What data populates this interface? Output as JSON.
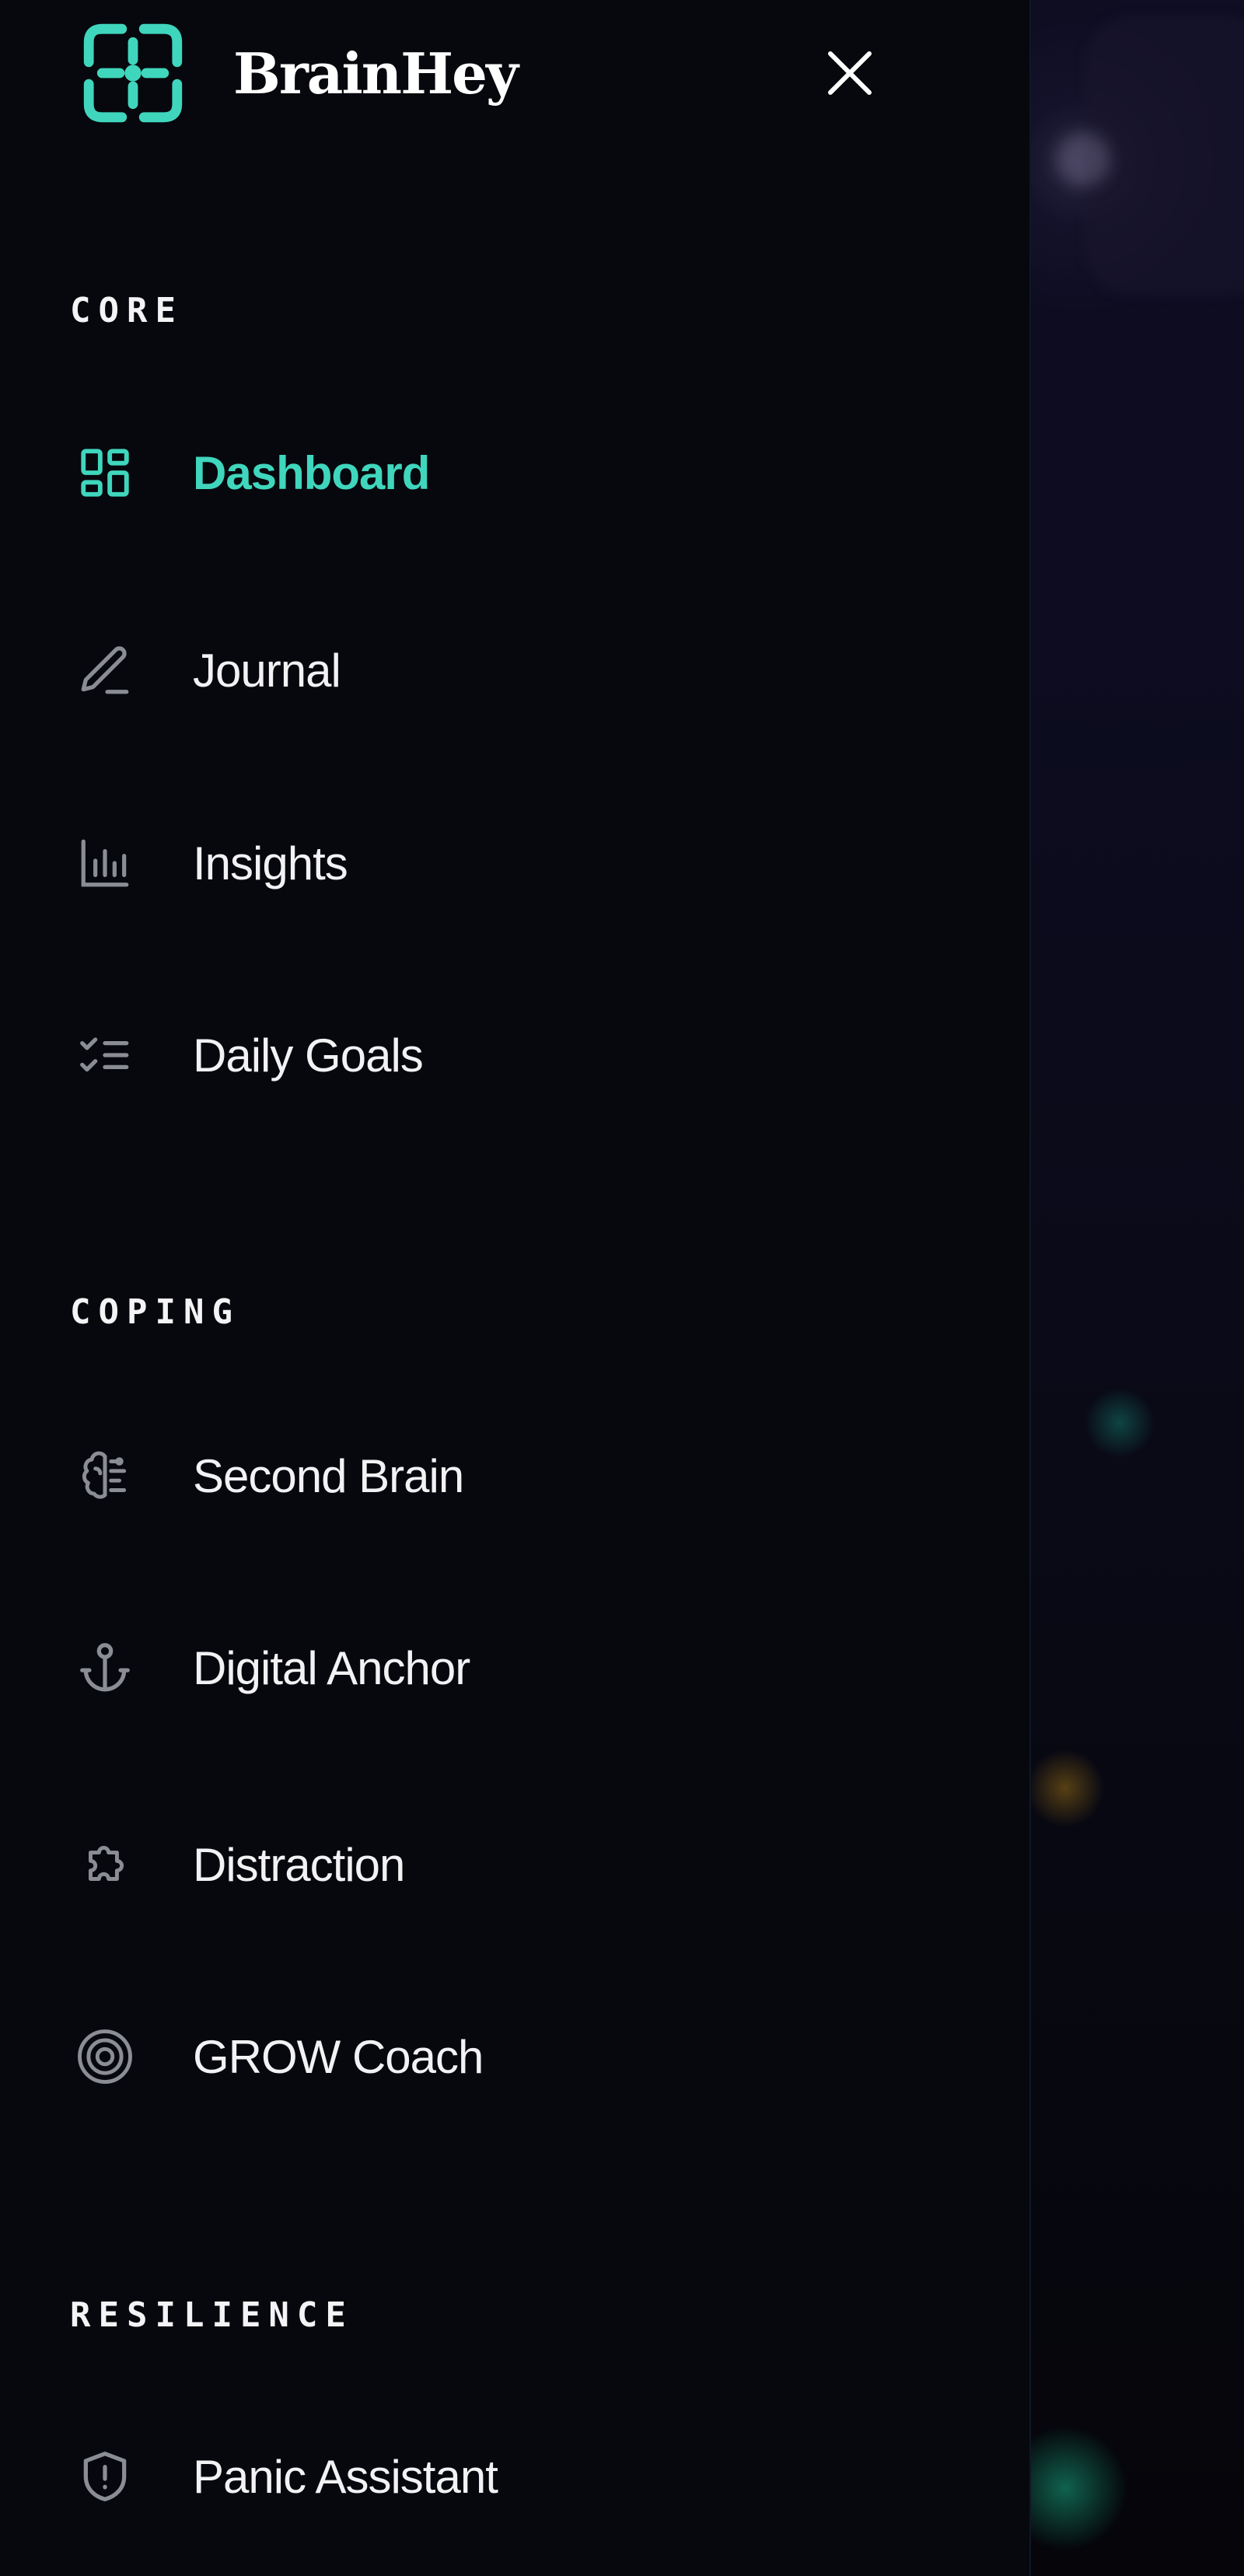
{
  "brand": {
    "name": "BrainHey",
    "accent_color": "#3fd6bd",
    "logo_icon": "brainhey-logo-icon"
  },
  "drawer": {
    "close_icon": "close-icon",
    "sections": [
      {
        "label": "CORE",
        "items": [
          {
            "label": "Dashboard",
            "icon": "dashboard-grid-icon",
            "active": true
          },
          {
            "label": "Journal",
            "icon": "pencil-icon",
            "active": false
          },
          {
            "label": "Insights",
            "icon": "bar-chart-icon",
            "active": false
          },
          {
            "label": "Daily Goals",
            "icon": "checklist-icon",
            "active": false
          }
        ]
      },
      {
        "label": "COPING",
        "items": [
          {
            "label": "Second Brain",
            "icon": "brain-icon",
            "active": false
          },
          {
            "label": "Digital Anchor",
            "icon": "anchor-icon",
            "active": false
          },
          {
            "label": "Distraction",
            "icon": "puzzle-icon",
            "active": false
          },
          {
            "label": "GROW Coach",
            "icon": "target-icon",
            "active": false
          }
        ]
      },
      {
        "label": "RESILIENCE",
        "items": [
          {
            "label": "Panic Assistant",
            "icon": "shield-alert-icon",
            "active": false
          }
        ]
      }
    ]
  },
  "colors": {
    "drawer_background": "#07080d",
    "text": "#f2f2f5",
    "icon_muted": "#8b8d95",
    "active": "#3fd6bd"
  }
}
